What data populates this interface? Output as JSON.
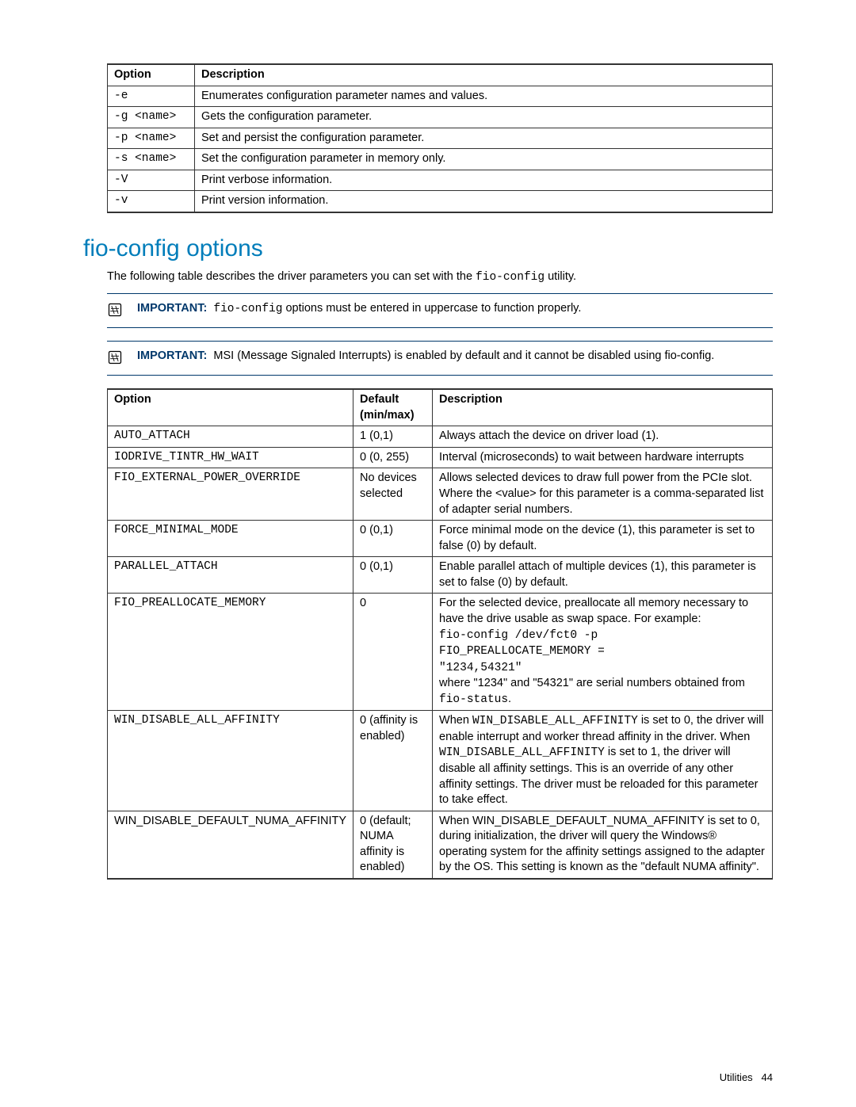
{
  "tables": {
    "options1": {
      "headers": [
        "Option",
        "Description"
      ],
      "rows": [
        {
          "opt": "-e",
          "desc": "Enumerates configuration parameter names and values."
        },
        {
          "opt": "-g <name>",
          "desc": "Gets the configuration parameter."
        },
        {
          "opt": "-p <name>",
          "desc": "Set and persist the configuration parameter."
        },
        {
          "opt": "-s <name>",
          "desc": "Set the configuration parameter in memory only."
        },
        {
          "opt": "-V",
          "desc": "Print verbose information."
        },
        {
          "opt": "-v",
          "desc": "Print version information."
        }
      ]
    },
    "options2": {
      "headers": [
        "Option",
        "Default (min/max)",
        "Description"
      ],
      "rows": [
        {
          "opt": "AUTO_ATTACH",
          "def": "1 (0,1)",
          "desc_plain": "Always attach the device on driver load (1)."
        },
        {
          "opt": "IODRIVE_TINTR_HW_WAIT",
          "def": "0 (0, 255)",
          "desc_plain": "Interval (microseconds) to wait between hardware interrupts"
        },
        {
          "opt": "FIO_EXTERNAL_POWER_OVERRIDE",
          "def": "No devices selected",
          "desc_plain": "Allows selected devices to draw full power from the PCIe slot. Where the <value> for this parameter is a comma-separated list of adapter serial numbers."
        },
        {
          "opt": "FORCE_MINIMAL_MODE",
          "def": "0 (0,1)",
          "desc_plain": "Force minimal mode on the device (1), this parameter is set to false (0) by default."
        },
        {
          "opt": "PARALLEL_ATTACH",
          "def": "0 (0,1)",
          "desc_plain": "Enable parallel attach of multiple devices (1), this parameter is set to false (0) by default."
        },
        {
          "opt": "FIO_PREALLOCATE_MEMORY",
          "def": "0",
          "desc_pre": "For the selected device, preallocate all memory necessary to have the drive usable as swap space. For example:",
          "code1": "fio-config /dev/fct0 -p",
          "code2": "FIO_PREALLOCATE_MEMORY =",
          "code3": "\"1234,54321\"",
          "desc_post_a": "where \"1234\" and \"54321\" are serial numbers obtained from ",
          "desc_post_code": "fio-status",
          "desc_post_b": "."
        },
        {
          "opt": "WIN_DISABLE_ALL_AFFINITY",
          "def": "0 (affinity is enabled)",
          "desc_a": "When ",
          "code_a": "WIN_DISABLE_ALL_AFFINITY",
          "desc_b": " is set to 0, the driver will enable interrupt and worker thread affinity in the driver. When ",
          "code_b": "WIN_DISABLE_ALL_AFFINITY",
          "desc_c": " is set to 1, the driver will disable all affinity settings. This is an override of any other affinity settings. The driver must be reloaded for this parameter to take effect."
        },
        {
          "opt_plain": "WIN_DISABLE_DEFAULT_NUMA_AFFINITY",
          "def": "0 (default; NUMA affinity is enabled)",
          "desc_plain": "When WIN_DISABLE_DEFAULT_NUMA_AFFINITY is set to 0, during initialization, the driver will query the Windows® operating system for the affinity settings assigned to the adapter by the OS. This setting is known as the \"default NUMA affinity\"."
        }
      ]
    }
  },
  "section_title": "fio-config options",
  "intro_a": "The following table describes the driver parameters you can set with the ",
  "intro_code": "fio-config",
  "intro_b": " utility.",
  "note1_label": "IMPORTANT:",
  "note1_code": "fio-config",
  "note1_text": " options must be entered in uppercase to function properly.",
  "note2_label": "IMPORTANT:",
  "note2_text": "MSI (Message Signaled Interrupts) is enabled by default and it cannot be disabled using fio-config.",
  "footer_label": "Utilities",
  "footer_page": "44"
}
